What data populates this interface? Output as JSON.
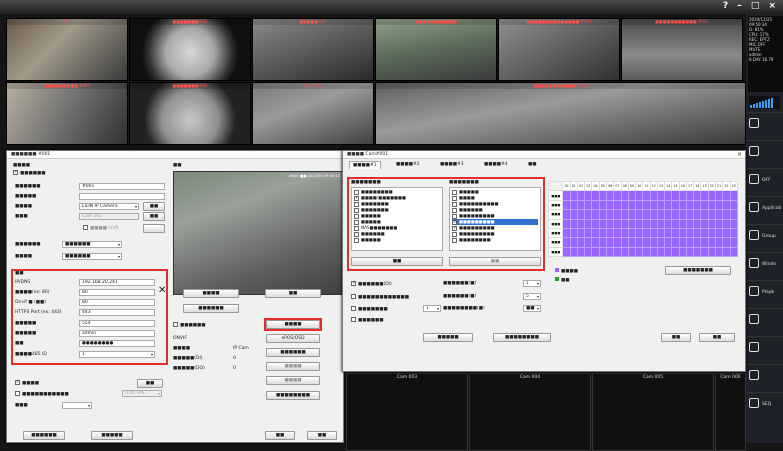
{
  "window": {
    "controls": "? – □ ×"
  },
  "cameras_top": [
    {
      "title": "001"
    },
    {
      "title": "■■■■■■■ 001"
    },
    {
      "title": "■■■■■ 001"
    },
    {
      "title": "■■■■■■■■■■■"
    },
    {
      "title": "■■■■■■■■■■■■■■ #001"
    },
    {
      "title": "■■■■■■■■■■■ #001"
    },
    {
      "title": "■■■■■■■■■ #001"
    },
    {
      "title": "■■■■■■■ 001"
    },
    {
      "title": "Cam 001"
    },
    {
      "title": "■■■■■■■■■■■ #001"
    }
  ],
  "status": {
    "lines": [
      "2020/12/25",
      "09:50:34",
      "D: 81%",
      "CPU: 17%",
      "REC: EPTZ",
      "MIC:OFF",
      "MUTE",
      "admin",
      "8 DAY 16.79"
    ]
  },
  "right_panel": [
    {
      "label": ""
    },
    {
      "label": ""
    },
    {
      "label": "OFF"
    },
    {
      "label": "Applicati"
    },
    {
      "label": "Group"
    },
    {
      "label": "Windo"
    },
    {
      "label": "Playb"
    },
    {
      "label": ""
    },
    {
      "label": ""
    },
    {
      "label": ""
    },
    {
      "label": ""
    },
    {
      "label": "SEQ"
    }
  ],
  "camera_dialog": {
    "title": "■■■■■■ #001",
    "section_settings": "■■■■",
    "enable_label": "■■■■■■",
    "fields": [
      {
        "label": "■■■■■■",
        "value": "#001"
      },
      {
        "label": "■■■■■",
        "value": ""
      },
      {
        "label": "■■■■",
        "value": "LILIN IP Camera"
      },
      {
        "label": "■■■",
        "value": "Cam 001"
      }
    ],
    "search_btn": "■■",
    "settings_btn": "■■",
    "nvr_label": "■■■■ LIVR",
    "fields2": [
      {
        "label": "■■■■■■",
        "value": "■■■■■■"
      },
      {
        "label": "■■■■",
        "value": "■■■■■■"
      }
    ],
    "network_title": "■■",
    "ip_fields": [
      {
        "label": "IP/DNS",
        "value": "192.168.20.241"
      },
      {
        "label": "■■■■(ex: 80)",
        "value": "80"
      },
      {
        "label": "Onvif ■ (■■)",
        "value": "80"
      },
      {
        "label": "HTTPS Port (ex: 443)",
        "value": "443"
      },
      {
        "label": "■■■■■",
        "value": "554"
      },
      {
        "label": "■■■■■",
        "value": "admin"
      },
      {
        "label": "■■",
        "value": "●●●●●●●●"
      },
      {
        "label": "■■■■485 ID",
        "value": "1"
      }
    ],
    "onvif_label": "ONVIF",
    "model_label": "■■■■",
    "model_value": "IP Cam",
    "out_in_label": "■■■■■(DI)",
    "out_in_value": "0",
    "out_do_label": "■■■■■(DO)",
    "out_do_value": "0",
    "preview_title": "■■",
    "preview_overlay": "#001 ■■ 2012/05 09:50:14",
    "buttons_mid": [
      "■■■■",
      "■■",
      "■■■■■■",
      "■■■■",
      "ePOS/OSD",
      "■■■■■■",
      "■■■■",
      "■■■■",
      "■■■■■■■■"
    ],
    "check_auto": "■■■■■■",
    "bottom_checks": [
      "■■■■",
      "■■■■■■■■■■■"
    ],
    "apply_btn": "■■",
    "ptz_label": "■■■",
    "ptz_value": "0.00 FPS",
    "footer_left": [
      "■■■■■■",
      "■■■■■"
    ],
    "ok_btn": "■■",
    "cancel_btn": "■■"
  },
  "event_dialog": {
    "title": "■■■■ Cam#001",
    "tabs": [
      "■■■■#1",
      "■■■■#2",
      "■■■■#3",
      "■■■■#4",
      "■■"
    ],
    "col1_title": "■■■■■■■",
    "col2_title": "■■■■■■■",
    "col1_items": [
      {
        "text": "■■■■■■■■",
        "checked": false
      },
      {
        "text": "■■■■/■■■■■■■",
        "checked": true
      },
      {
        "text": "■■■■■■■",
        "checked": false
      },
      {
        "text": "■■■■■■■",
        "checked": false
      },
      {
        "text": "■■■■■",
        "checked": false
      },
      {
        "text": "■■■■■",
        "checked": false
      },
      {
        "text": "NAS■■■■■■■",
        "checked": false
      },
      {
        "text": "■■■■■■",
        "checked": false
      },
      {
        "text": "■■■■■",
        "checked": false
      }
    ],
    "col2_items": [
      {
        "text": "■■■■■",
        "checked": false
      },
      {
        "text": "■■■■",
        "checked": false
      },
      {
        "text": "■■■■■■■■■■",
        "checked": false
      },
      {
        "text": "■■■■■■",
        "checked": false
      },
      {
        "text": "■■■■■■■■■",
        "checked": false
      },
      {
        "text": "■■■■■■■■■",
        "checked": true,
        "highlight": true
      },
      {
        "text": "■■■■■■■■■",
        "checked": true
      },
      {
        "text": "■■■■■■■■■",
        "checked": false
      },
      {
        "text": "■■■■■■■■",
        "checked": false
      }
    ],
    "btn_select": "■■",
    "btn_clear": "■■",
    "opts": [
      {
        "text": "■■■■■■(DI)",
        "checked": true
      },
      {
        "text": "■■■■■■■■■■■■",
        "checked": false
      },
      {
        "text": "■■■■■■■",
        "checked": false
      },
      {
        "text": "■■■■■■",
        "checked": false
      }
    ],
    "opt_values": [
      "1",
      "1"
    ],
    "right_opts": [
      {
        "label": "■■■■■■(■)",
        "value": "1"
      },
      {
        "label": "■■■■■■(■)",
        "value": "5"
      },
      {
        "label": "■■■■■■■■(■)",
        "value": "■■"
      }
    ],
    "legend_on": "■■■■",
    "legend_off": "■■",
    "copy_btn": "■■■■■■■",
    "footer_btns": [
      "■■■■■",
      "■■■■■■■■"
    ],
    "ok_btn": "■■",
    "cancel_btn": "■■",
    "days": [
      "■■■",
      "■■■",
      "■■■",
      "■■■",
      "■■■",
      "■■■",
      "■■■"
    ],
    "hours": [
      "00",
      "01",
      "02",
      "03",
      "04",
      "05",
      "06",
      "07",
      "08",
      "09",
      "10",
      "11",
      "12",
      "13",
      "14",
      "15",
      "16",
      "17",
      "18",
      "19",
      "20",
      "21",
      "22",
      "23"
    ]
  },
  "cameras_bottom": [
    "Cam 003",
    "Cam 004",
    "Cam 005",
    "Cam 006"
  ],
  "colors": {
    "accent_red": "#e0302a",
    "schedule": "#9966ff"
  }
}
